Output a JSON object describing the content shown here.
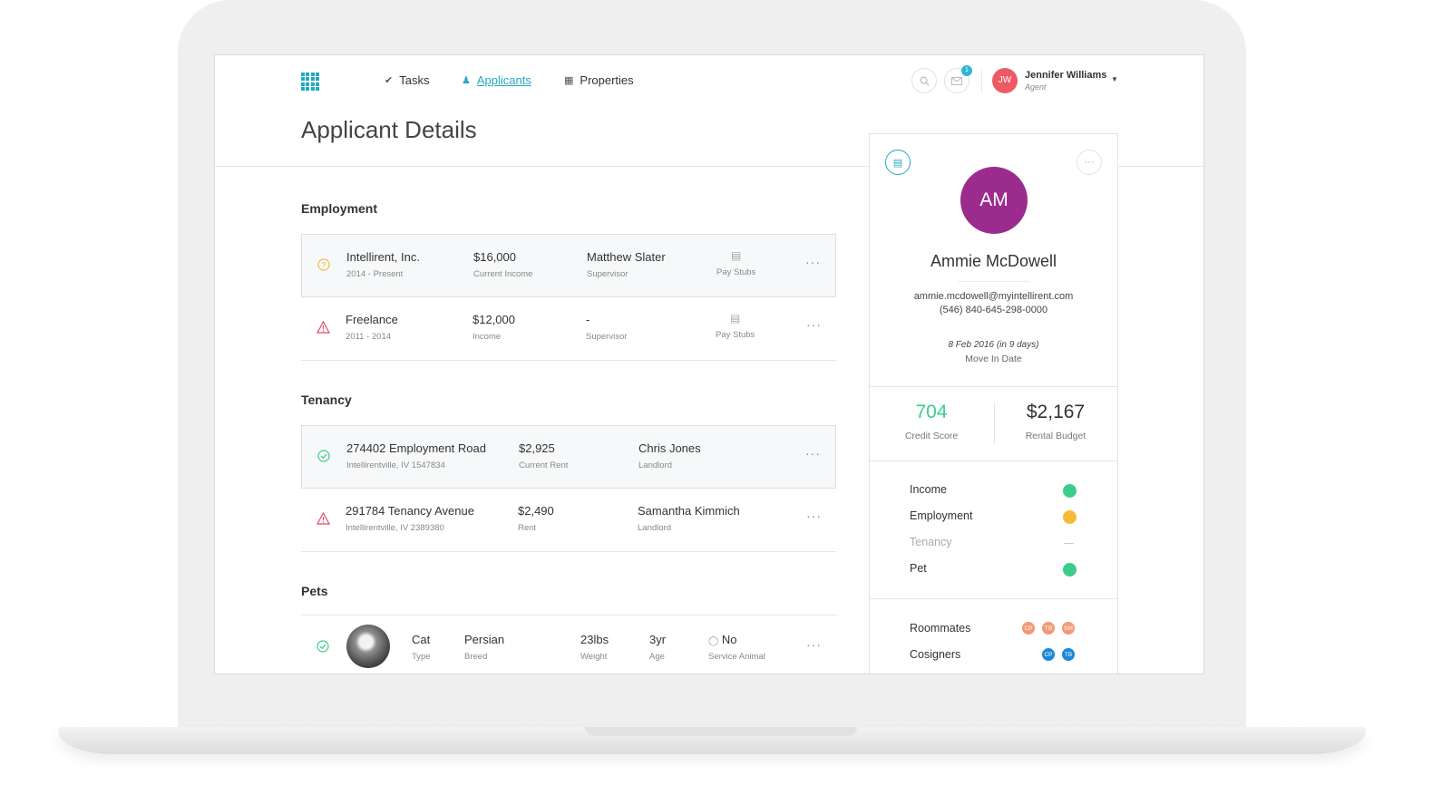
{
  "nav": {
    "tasks": "Tasks",
    "applicants": "Applicants",
    "properties": "Properties"
  },
  "header": {
    "notification_count": "1",
    "user_initials": "JW",
    "user_name": "Jennifer Williams",
    "user_role": "Agent"
  },
  "page_title": "Applicant Details",
  "employment": {
    "title": "Employment",
    "rows": [
      {
        "status": "pending",
        "company": "Intellirent, Inc.",
        "period": "2014 - Present",
        "amount": "$16,000",
        "amount_label": "Current Income",
        "supervisor": "Matthew Slater",
        "supervisor_label": "Supervisor",
        "docs_label": "Pay Stubs"
      },
      {
        "status": "warning",
        "company": "Freelance",
        "period": "2011 - 2014",
        "amount": "$12,000",
        "amount_label": "Income",
        "supervisor": "-",
        "supervisor_label": "Supervisor",
        "docs_label": "Pay Stubs"
      }
    ]
  },
  "tenancy": {
    "title": "Tenancy",
    "rows": [
      {
        "status": "ok",
        "address": "274402 Employment Road",
        "city": "Intellirentville, IV 1547834",
        "rent": "$2,925",
        "rent_label": "Current Rent",
        "landlord": "Chris Jones",
        "landlord_label": "Landlord"
      },
      {
        "status": "warning",
        "address": "291784 Tenancy Avenue",
        "city": "Intellirentville, IV 2389380",
        "rent": "$2,490",
        "rent_label": "Rent",
        "landlord": "Samantha Kimmich",
        "landlord_label": "Landlord"
      }
    ]
  },
  "pets": {
    "title": "Pets",
    "rows": [
      {
        "status": "ok",
        "type": "Cat",
        "type_label": "Type",
        "breed": "Persian",
        "breed_label": "Breed",
        "weight": "23lbs",
        "weight_label": "Weight",
        "age": "3yr",
        "age_label": "Age",
        "service": "No",
        "service_label": "Service Animal"
      }
    ]
  },
  "profile": {
    "initials": "AM",
    "name": "Ammie McDowell",
    "email": "ammie.mcdowell@myintellirent.com",
    "phone": "(546) 840-645-298-0000",
    "move_in_date": "8 Feb 2016 (in 9 days)",
    "move_in_label": "Move In Date",
    "credit_score": "704",
    "credit_score_label": "Credit Score",
    "rental_budget": "$2,167",
    "rental_budget_label": "Rental Budget",
    "checks": [
      {
        "label": "Income",
        "state": "ok"
      },
      {
        "label": "Employment",
        "state": "pending"
      },
      {
        "label": "Tenancy",
        "state": "none"
      },
      {
        "label": "Pet",
        "state": "ok"
      }
    ],
    "roommates_label": "Roommates",
    "roommates": [
      "CP",
      "TB",
      "SM"
    ],
    "cosigners_label": "Cosigners",
    "cosigners": [
      "CP",
      "TB"
    ]
  },
  "colors": {
    "accent": "#25a7c6",
    "ok": "#3ccd8c",
    "pending": "#f4bb3b",
    "warning": "#e64860",
    "avatar_profile": "#9b2c8d",
    "avatar_user": "#ee5a63",
    "roommate": "#f39a72",
    "cosigner": "#1e88d6"
  },
  "icons": [
    "grid-logo-icon",
    "check-circle-icon",
    "people-icon",
    "building-icon",
    "search-icon",
    "mail-icon",
    "caret-down-icon",
    "question-circle-icon",
    "warning-triangle-icon",
    "document-icon",
    "more-horizontal-icon",
    "info-circle-icon"
  ]
}
